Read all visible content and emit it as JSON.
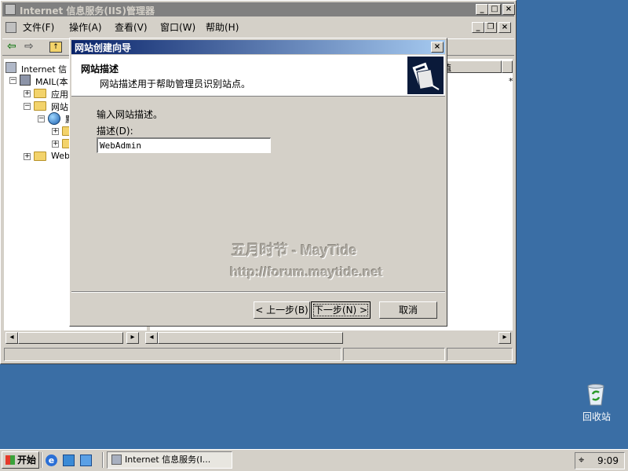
{
  "iis_window": {
    "title": "Internet 信息服务(IIS)管理器",
    "menu": [
      {
        "label": "文件(F)"
      },
      {
        "label": "操作(A)"
      },
      {
        "label": "查看(V)"
      },
      {
        "label": "窗口(W)"
      },
      {
        "label": "帮助(H)"
      }
    ],
    "tree": {
      "root": "Internet 信",
      "server": "MAIL(本",
      "app_pools": "应用",
      "websites": "网站",
      "default_site": "默",
      "web": "Web"
    },
    "right_header": "值",
    "right_star": "*"
  },
  "wizard": {
    "title": "网站创建向导",
    "header_title": "网站描述",
    "header_subtitle": "网站描述用于帮助管理员识别站点。",
    "instruction": "输入网站描述。",
    "field_label": "描述(D):",
    "field_value": "WebAdmin",
    "buttons": {
      "back": "< 上一步(B)",
      "next": "下一步(N) >",
      "cancel": "取消"
    }
  },
  "watermark": {
    "line1": "五月时节 - MayTide",
    "line2": "http://forum.maytide.net"
  },
  "desktop": {
    "recycle_bin": "回收站"
  },
  "taskbar": {
    "start": "开始",
    "task_label": "Internet 信息服务(I...",
    "clock": "9:09"
  },
  "colors": {
    "desktop": "#3a6ea5",
    "face": "#d4d0c8",
    "active_title": "#0a246a"
  }
}
